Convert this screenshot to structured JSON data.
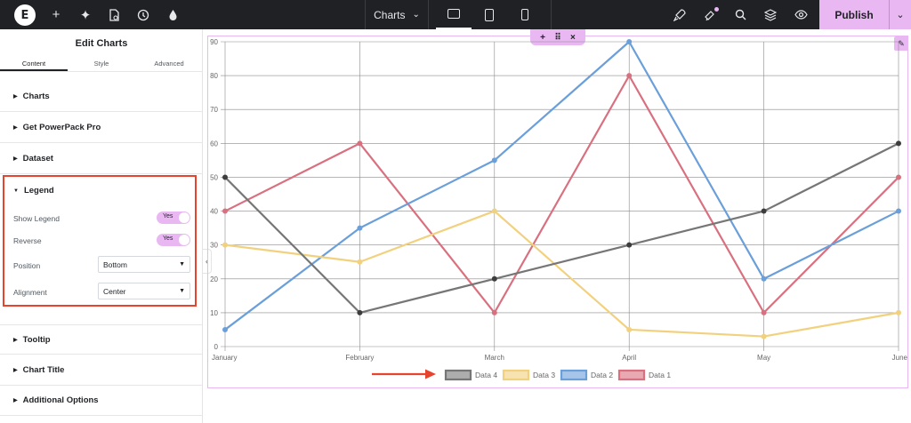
{
  "topbar": {
    "doc_title": "Charts",
    "publish_label": "Publish",
    "icons": [
      "elementor-logo-icon",
      "add-icon",
      "ai-sparkle-icon",
      "page-settings-icon",
      "history-icon",
      "theme-style-icon",
      "rocket-icon",
      "notifications-icon",
      "search-icon",
      "structure-layers-icon",
      "preview-eye-icon"
    ],
    "devices": [
      "desktop-icon",
      "tablet-icon",
      "mobile-icon"
    ]
  },
  "panel": {
    "title": "Edit Charts",
    "tabs": [
      "Content",
      "Style",
      "Advanced"
    ],
    "sections_top": [
      "Charts",
      "Get PowerPack Pro",
      "Dataset"
    ],
    "legend": {
      "title": "Legend",
      "show_legend_label": "Show Legend",
      "show_legend_value": "Yes",
      "reverse_label": "Reverse",
      "reverse_value": "Yes",
      "position_label": "Position",
      "position_value": "Bottom",
      "alignment_label": "Alignment",
      "alignment_value": "Center"
    },
    "sections_bottom": [
      "Tooltip",
      "Chart Title",
      "Additional Options"
    ]
  },
  "colors": {
    "accent": "#e9b8f3",
    "highlight_border": "#e7432d"
  },
  "chart_data": {
    "type": "line",
    "categories": [
      "January",
      "February",
      "March",
      "April",
      "May",
      "June"
    ],
    "ylim": [
      0,
      90
    ],
    "yticks": [
      0,
      10,
      20,
      30,
      40,
      50,
      60,
      70,
      80,
      90
    ],
    "grid": true,
    "legend_position": "bottom-center",
    "series": [
      {
        "name": "Data 1",
        "color": "#d9707f",
        "values": [
          40,
          60,
          10,
          80,
          10,
          50
        ]
      },
      {
        "name": "Data 2",
        "color": "#6a9fda",
        "values": [
          5,
          35,
          55,
          90,
          20,
          40
        ]
      },
      {
        "name": "Data 3",
        "color": "#f2d17e",
        "values": [
          30,
          25,
          40,
          5,
          3,
          10
        ]
      },
      {
        "name": "Data 4",
        "color": "#767676",
        "values": [
          50,
          10,
          20,
          30,
          40,
          60
        ]
      }
    ],
    "legend_order": [
      "Data 4",
      "Data 3",
      "Data 2",
      "Data 1"
    ]
  }
}
